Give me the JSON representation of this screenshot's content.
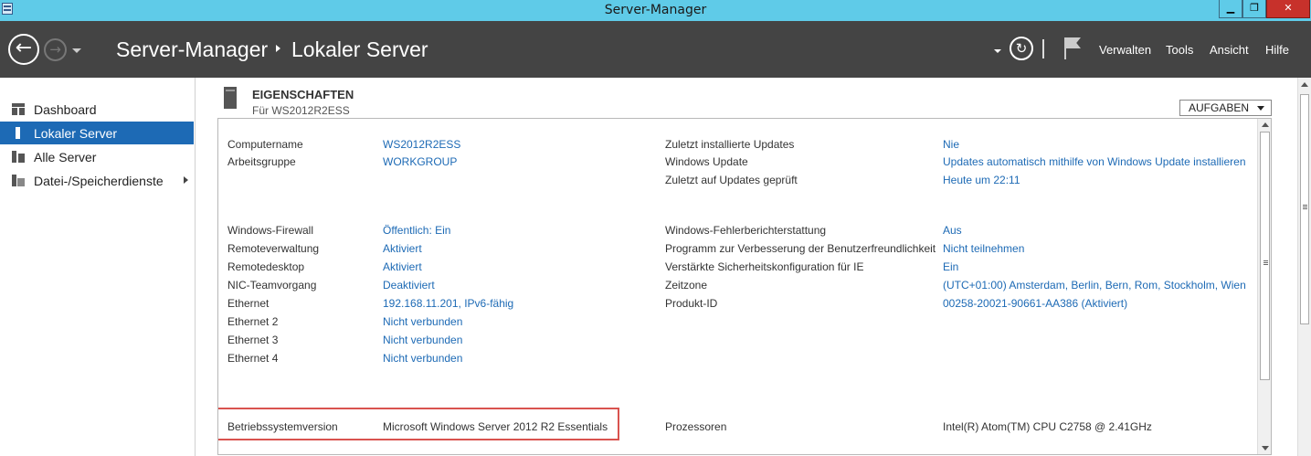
{
  "window": {
    "title": "Server-Manager",
    "min_glyph": "▁",
    "max_glyph": "❐",
    "close_glyph": "✕"
  },
  "header": {
    "back_glyph": "←",
    "forward_glyph": "→",
    "breadcrumb_root": "Server-Manager",
    "breadcrumb_current": "Lokaler Server",
    "refresh_glyph": "↻",
    "menu": [
      "Verwalten",
      "Tools",
      "Ansicht",
      "Hilfe"
    ]
  },
  "sidebar": {
    "items": [
      {
        "label": "Dashboard",
        "icon": "dashboard-icon",
        "active": false
      },
      {
        "label": "Lokaler Server",
        "icon": "local-server-icon",
        "active": true
      },
      {
        "label": "Alle Server",
        "icon": "all-servers-icon",
        "active": false
      },
      {
        "label": "Datei-/Speicherdienste",
        "icon": "file-storage-icon",
        "active": false,
        "has_submenu": true
      }
    ]
  },
  "properties": {
    "title": "EIGENSCHAFTEN",
    "subtitle": "Für WS2012R2ESS",
    "tasks_label": "AUFGABEN",
    "left": [
      {
        "label": "Computername",
        "value": "WS2012R2ESS"
      },
      {
        "label": "Arbeitsgruppe",
        "value": "WORKGROUP"
      },
      {
        "label": "Windows-Firewall",
        "value": "Öffentlich: Ein"
      },
      {
        "label": "Remoteverwaltung",
        "value": "Aktiviert"
      },
      {
        "label": "Remotedesktop",
        "value": "Aktiviert"
      },
      {
        "label": "NIC-Teamvorgang",
        "value": "Deaktiviert"
      },
      {
        "label": "Ethernet",
        "value": "192.168.11.201, IPv6-fähig"
      },
      {
        "label": "Ethernet 2",
        "value": "Nicht verbunden"
      },
      {
        "label": "Ethernet 3",
        "value": "Nicht verbunden"
      },
      {
        "label": "Ethernet 4",
        "value": "Nicht verbunden"
      }
    ],
    "right": [
      {
        "label": "Zuletzt installierte Updates",
        "value": "Nie"
      },
      {
        "label": "Windows Update",
        "value": "Updates automatisch mithilfe von Windows Update installieren"
      },
      {
        "label": "Zuletzt auf Updates geprüft",
        "value": "Heute um 22:11"
      },
      {
        "label": "Windows-Fehlerberichterstattung",
        "value": "Aus"
      },
      {
        "label": "Programm zur Verbesserung der Benutzerfreundlichkeit",
        "value": "Nicht teilnehmen"
      },
      {
        "label": "Verstärkte Sicherheitskonfiguration für IE",
        "value": "Ein"
      },
      {
        "label": "Zeitzone",
        "value": "(UTC+01:00) Amsterdam, Berlin, Bern, Rom, Stockholm, Wien"
      },
      {
        "label": "Produkt-ID",
        "value": "00258-20021-90661-AA386 (Aktiviert)"
      }
    ],
    "bottom": {
      "os_label": "Betriebssystemversion",
      "os_value": "Microsoft Windows Server 2012 R2 Essentials",
      "cpu_label": "Prozessoren",
      "cpu_value": "Intel(R) Atom(TM) CPU  C2758  @ 2.41GHz"
    }
  },
  "colors": {
    "titlebar": "#5fcbe8",
    "header": "#444444",
    "accent": "#1d6ab5",
    "highlight_box": "#d9534f"
  }
}
